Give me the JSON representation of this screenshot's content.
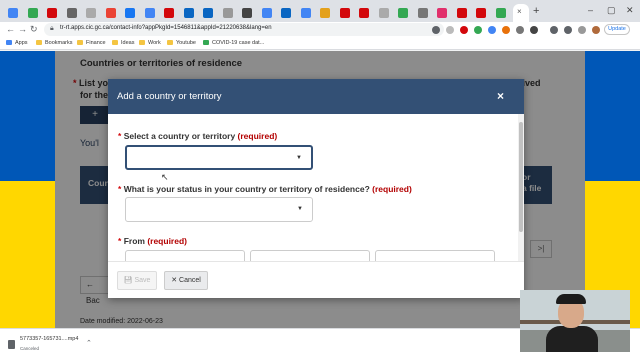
{
  "browser": {
    "tab_close": "×",
    "new_tab": "+",
    "window_controls": [
      "–",
      "▢",
      "✕"
    ],
    "url": "tr-rt.apps.cic.gc.ca/contact-info?appPkgId=1546811&appId=21220638&lang=en",
    "update_label": "Update",
    "tab_favicon_colors": [
      "#4285f4",
      "#34a853",
      "#d3080c",
      "#666",
      "#aaa",
      "#ea4335",
      "#1877f2",
      "#4285f4",
      "#d3080c",
      "#0a66c2",
      "#0a66c2",
      "#999",
      "#444",
      "#4285f4",
      "#0a66c2",
      "#4285f4",
      "#e4a11b",
      "#d3080c",
      "#d3080c",
      "#aaa",
      "#34a853",
      "#777",
      "#e1306c",
      "#d3080c",
      "#d3080c",
      "#34a853"
    ]
  },
  "bookmarks": [
    "Apps",
    "Bookmarks",
    "Finance",
    "Ideas",
    "Work",
    "Youtube",
    "COVID-19 case dat..."
  ],
  "page": {
    "heading": "Countries or territories of residence",
    "required_intro": "List your",
    "required_intro2": "for the",
    "required_tail": "lived",
    "add_button": "+",
    "link_text": "You'l",
    "table_col1": "Coun",
    "table_col2_line1": "or",
    "table_col2_line2": "a file",
    "pager_next": ">|",
    "back_button": "Bac",
    "date_modified": "Date modified: 2022-06-23"
  },
  "modal": {
    "title": "Add a country or territory",
    "close": "×",
    "fields": [
      {
        "label": "Select a country or territory",
        "required": "(required)",
        "value": ""
      },
      {
        "label": "What is your status in your country or territory of residence?",
        "required": "(required)",
        "value": ""
      },
      {
        "label": "From",
        "required": "(required)"
      }
    ],
    "star": "*",
    "save_label": "Save",
    "cancel_label": "Cancel",
    "cancel_icon": "✕"
  },
  "download": {
    "filename": "5773357-165731....mp4",
    "status": "Canceled"
  }
}
